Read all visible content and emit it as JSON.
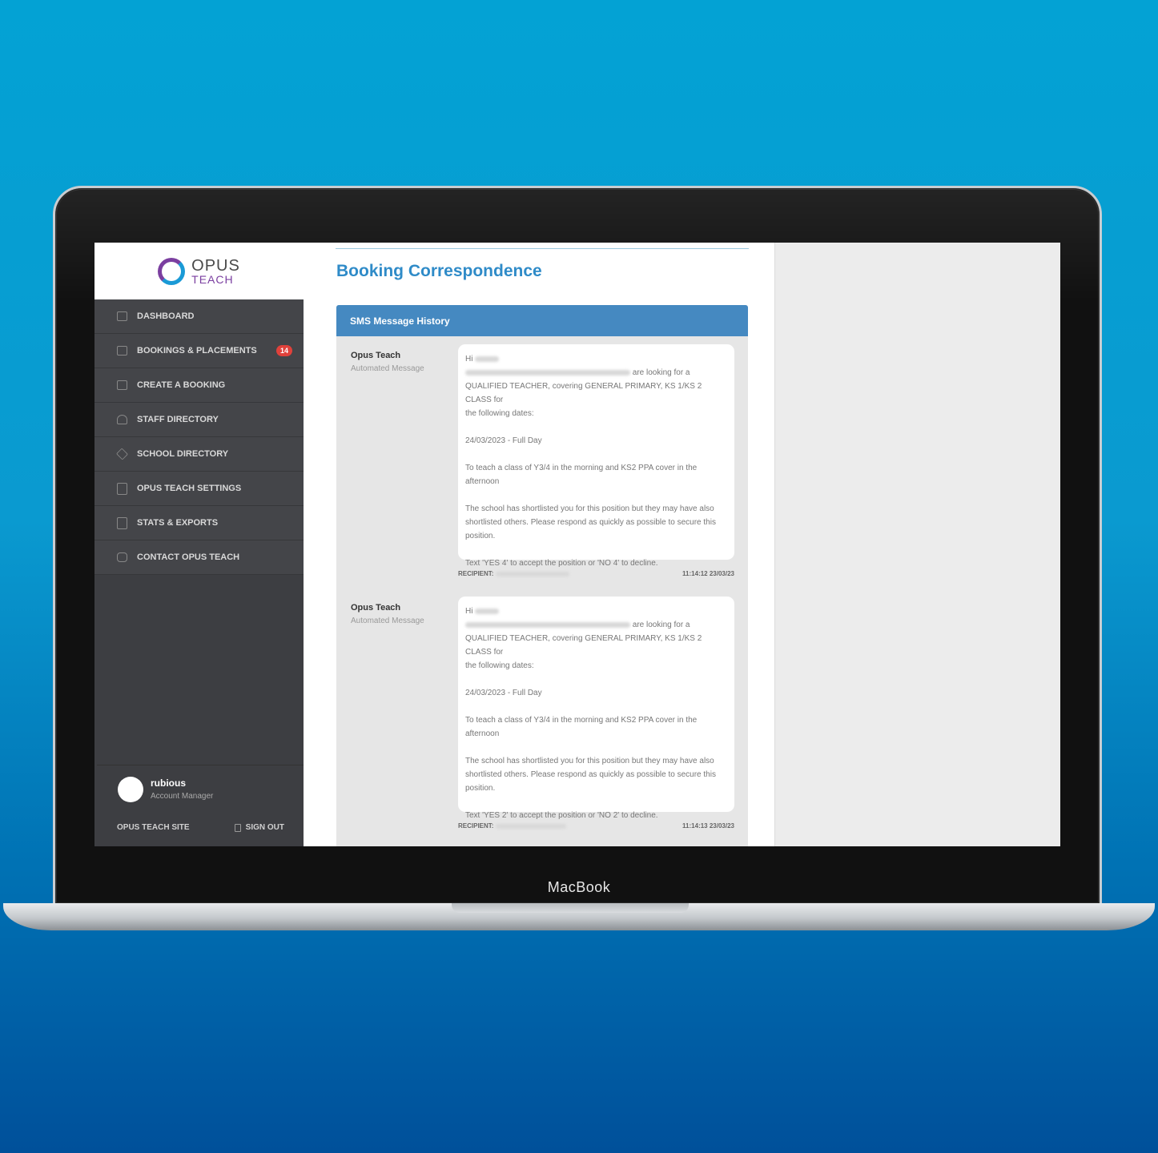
{
  "device": {
    "brand_label": "MacBook"
  },
  "logo": {
    "line1": "OPUS",
    "line2": "TEACH"
  },
  "nav": {
    "items": [
      {
        "label": "DASHBOARD",
        "icon": "dashboard-icon"
      },
      {
        "label": "BOOKINGS & PLACEMENTS",
        "icon": "briefcase-icon",
        "badge": "14"
      },
      {
        "label": "CREATE A BOOKING",
        "icon": "calendar-icon"
      },
      {
        "label": "STAFF DIRECTORY",
        "icon": "person-icon"
      },
      {
        "label": "SCHOOL DIRECTORY",
        "icon": "graduation-cap-icon"
      },
      {
        "label": "OPUS TEACH SETTINGS",
        "icon": "clipboard-icon"
      },
      {
        "label": "STATS & EXPORTS",
        "icon": "clipboard-icon"
      },
      {
        "label": "CONTACT OPUS TEACH",
        "icon": "chat-icon"
      }
    ]
  },
  "user": {
    "name": "rubious",
    "role": "Account Manager"
  },
  "footer": {
    "site_link": "OPUS TEACH SITE",
    "sign_out": "SIGN OUT"
  },
  "page": {
    "title": "Booking Correspondence"
  },
  "panel": {
    "title": "SMS Message History"
  },
  "messages": [
    {
      "sender": "Opus Teach",
      "sender_sub": "Automated Message",
      "greeting": "Hi",
      "line_school_suffix": "are looking for a",
      "line_role": "QUALIFIED TEACHER, covering GENERAL PRIMARY, KS 1/KS 2 CLASS for",
      "line_dates_intro": "the following dates:",
      "date_line": "24/03/2023 - Full Day",
      "task_line1": "To teach a class of Y3/4 in the morning and KS2 PPA cover in the",
      "task_line2": "afternoon",
      "shortlist_line1": "The school has shortlisted you for this position but they may have also",
      "shortlist_line2": "shortlisted others. Please respond as quickly as possible to secure this",
      "shortlist_line3": "position.",
      "reply_line": "Text 'YES 4' to accept the position or 'NO 4' to decline.",
      "recipient_label": "RECIPIENT:",
      "timestamp": "11:14:12 23/03/23"
    },
    {
      "sender": "Opus Teach",
      "sender_sub": "Automated Message",
      "greeting": "Hi",
      "line_school_suffix": "are looking for a",
      "line_role": "QUALIFIED TEACHER, covering GENERAL PRIMARY, KS 1/KS 2 CLASS for",
      "line_dates_intro": "the following dates:",
      "date_line": "24/03/2023 - Full Day",
      "task_line1": "To teach a class of Y3/4 in the morning and KS2 PPA cover in the",
      "task_line2": "afternoon",
      "shortlist_line1": "The school has shortlisted you for this position but they may have also",
      "shortlist_line2": "shortlisted others. Please respond as quickly as possible to secure this",
      "shortlist_line3": "position.",
      "reply_line": "Text 'YES 2' to accept the position or 'NO 2' to decline.",
      "recipient_label": "RECIPIENT:",
      "timestamp": "11:14:13 23/03/23"
    }
  ]
}
